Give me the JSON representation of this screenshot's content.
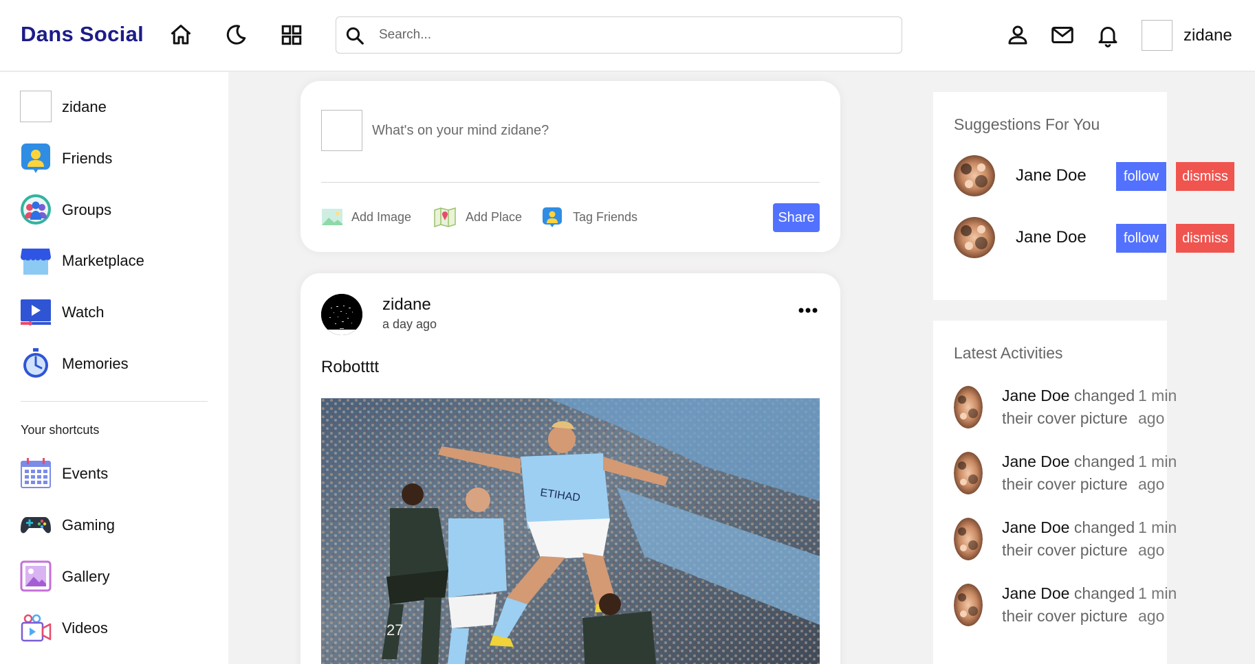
{
  "navbar": {
    "logo": "Dans Social",
    "search_placeholder": "Search...",
    "username": "zidane",
    "icons": [
      "home-icon",
      "moon-icon",
      "grid-icon",
      "person-icon",
      "mail-icon",
      "bell-icon"
    ]
  },
  "sidebar": {
    "items": [
      {
        "label": "zidane",
        "icon": "user-avatar"
      },
      {
        "label": "Friends",
        "icon": "friends-icon"
      },
      {
        "label": "Groups",
        "icon": "groups-icon"
      },
      {
        "label": "Marketplace",
        "icon": "marketplace-icon"
      },
      {
        "label": "Watch",
        "icon": "watch-icon"
      },
      {
        "label": "Memories",
        "icon": "memories-icon"
      }
    ],
    "shortcuts_heading": "Your shortcuts",
    "shortcuts": [
      {
        "label": "Events",
        "icon": "events-icon"
      },
      {
        "label": "Gaming",
        "icon": "gaming-icon"
      },
      {
        "label": "Gallery",
        "icon": "gallery-icon"
      },
      {
        "label": "Videos",
        "icon": "videos-icon"
      }
    ]
  },
  "composer": {
    "placeholder": "What's on your mind zidane?",
    "add_image": "Add Image",
    "add_place": "Add Place",
    "tag_friends": "Tag Friends",
    "share": "Share"
  },
  "post": {
    "author": "zidane",
    "time": "a day ago",
    "text": "Robotttt"
  },
  "suggestions": {
    "title": "Suggestions For You",
    "items": [
      {
        "name": "Jane Doe",
        "follow": "follow",
        "dismiss": "dismiss"
      },
      {
        "name": "Jane Doe",
        "follow": "follow",
        "dismiss": "dismiss"
      }
    ]
  },
  "activities": {
    "title": "Latest Activities",
    "items": [
      {
        "name": "Jane Doe",
        "action": "changed their cover picture",
        "time": "1 min ago"
      },
      {
        "name": "Jane Doe",
        "action": "changed their cover picture",
        "time": "1 min ago"
      },
      {
        "name": "Jane Doe",
        "action": "changed their cover picture",
        "time": "1 min ago"
      },
      {
        "name": "Jane Doe",
        "action": "changed their cover picture",
        "time": "1 min ago"
      }
    ]
  },
  "colors": {
    "brand": "#1c1c8a",
    "accent": "#5271ff",
    "danger": "#f0544f",
    "background": "#f3f2f2"
  }
}
